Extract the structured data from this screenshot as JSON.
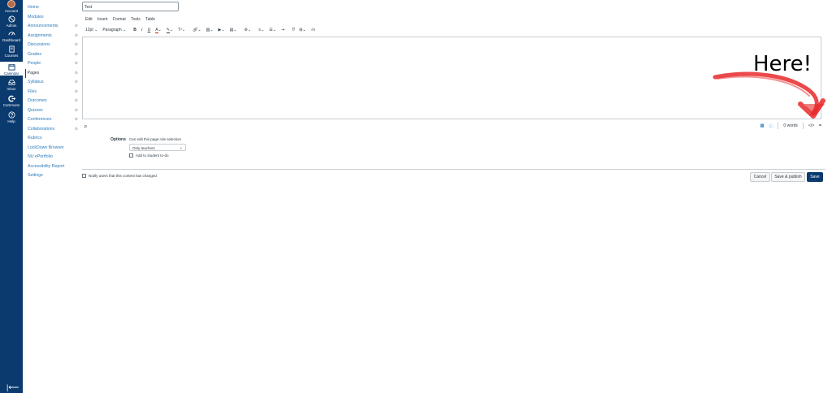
{
  "global_nav": {
    "items": [
      {
        "label": "Account",
        "icon": "avatar-icon"
      },
      {
        "label": "Admin",
        "icon": "shield-icon"
      },
      {
        "label": "Dashboard",
        "icon": "dashboard-icon"
      },
      {
        "label": "Courses",
        "icon": "book-icon"
      },
      {
        "label": "Calendar",
        "icon": "calendar-icon"
      },
      {
        "label": "Inbox",
        "icon": "inbox-icon"
      },
      {
        "label": "Commons",
        "icon": "commons-icon"
      },
      {
        "label": "Help",
        "icon": "help-icon"
      }
    ],
    "active": "Courses",
    "colors": {
      "background": "#0a3a6e"
    }
  },
  "course_nav": {
    "items": [
      {
        "label": "Home",
        "hidden": false
      },
      {
        "label": "Modules",
        "hidden": false
      },
      {
        "label": "Announcements",
        "hidden": true
      },
      {
        "label": "Assignments",
        "hidden": true
      },
      {
        "label": "Discussions",
        "hidden": true
      },
      {
        "label": "Grades",
        "hidden": true
      },
      {
        "label": "People",
        "hidden": true
      },
      {
        "label": "Pages",
        "hidden": true
      },
      {
        "label": "Syllabus",
        "hidden": true
      },
      {
        "label": "Files",
        "hidden": true
      },
      {
        "label": "Outcomes",
        "hidden": true
      },
      {
        "label": "Quizzes",
        "hidden": true
      },
      {
        "label": "Conferences",
        "hidden": true
      },
      {
        "label": "Collaborations",
        "hidden": true
      },
      {
        "label": "Rubrics",
        "hidden": false
      },
      {
        "label": "LockDown Browser",
        "hidden": false
      },
      {
        "label": "NU ePortfolio",
        "hidden": false
      },
      {
        "label": "Accessibility Report",
        "hidden": false
      },
      {
        "label": "Settings",
        "hidden": false
      }
    ],
    "active": "Pages"
  },
  "editor": {
    "title_value": "Test",
    "menu": [
      "Edit",
      "Insert",
      "Format",
      "Tools",
      "Table"
    ],
    "font_size": "12pt",
    "block_format": "Paragraph",
    "status_path": "p",
    "word_count": "0 words"
  },
  "options": {
    "label": "Options",
    "help": "Can edit this page role selection",
    "select_value": "Only teachers",
    "todo_label": "Add to student to-do"
  },
  "footer": {
    "notify_label": "Notify users that this content has changed",
    "cancel": "Cancel",
    "save_publish": "Save & publish",
    "save": "Save"
  },
  "annotation": {
    "text": "Here!",
    "color": "#e8292b"
  }
}
